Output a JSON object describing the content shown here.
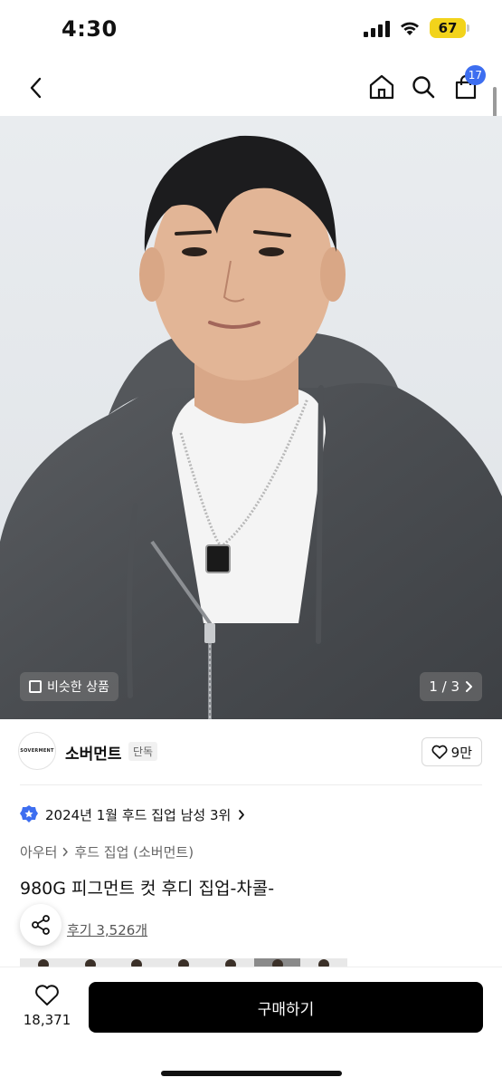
{
  "status": {
    "time": "4:30",
    "battery": "67",
    "battery_color": "#f2d31b"
  },
  "nav": {
    "back_icon": "chevron-left-icon",
    "home_icon": "home-icon",
    "search_icon": "search-icon",
    "bag_icon": "shopping-bag-icon",
    "bag_badge": "17",
    "badge_color": "#3d6ef0"
  },
  "hero": {
    "similar_label": "비슷한 상품",
    "page_counter": "1 / 3"
  },
  "brand": {
    "logo_text": "SOVERMENT",
    "name": "소버먼트",
    "tag": "단독",
    "likes": "9만"
  },
  "ranking": {
    "text": "2024년 1월 후드 집업 남성 3위"
  },
  "breadcrumb": {
    "category": "아우터",
    "subcategory": "후드 집업 (소버먼트)"
  },
  "product": {
    "title": "980G 피그먼트 컷 후디 집업-차콜-",
    "reviews": "후기 3,526개"
  },
  "bottom": {
    "wish_count": "18,371",
    "buy_label": "구매하기",
    "buy_color": "#000000"
  }
}
